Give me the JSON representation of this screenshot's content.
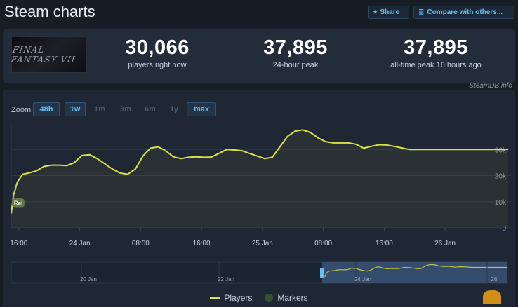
{
  "header": {
    "title": "Steam charts",
    "share_label": "Share",
    "compare_label": "Compare with others..."
  },
  "icons": {
    "share": "share-icon",
    "compare": "compare-icon"
  },
  "stats": {
    "logo_text": "FINAL FANTASY VII",
    "current": {
      "value": "30,066",
      "label": "players right now"
    },
    "peak24": {
      "value": "37,895",
      "label": "24-hour peak"
    },
    "alltime": {
      "value": "37,895",
      "label": "all-time peak 16 hours ago"
    }
  },
  "credit": "SteamDB.info",
  "zoom": {
    "label": "Zoom",
    "options": [
      "48h",
      "1w",
      "1m",
      "3m",
      "6m",
      "1y",
      "max"
    ],
    "active": [
      "48h",
      "1w",
      "max"
    ]
  },
  "legend": {
    "players": "Players",
    "markers": "Markers"
  },
  "colors": {
    "accent": "#66c0f4",
    "series": "#d6e34a",
    "navigator_fill": "#3a5378"
  },
  "chart_data": {
    "type": "area",
    "title": "",
    "series": [
      {
        "name": "Players",
        "x_hours": [
          0,
          0.3,
          0.8,
          1.5,
          2.3,
          3.3,
          4.3,
          5.3,
          6.3,
          7.3,
          8.3,
          9.3,
          10.3,
          11.3,
          12.3,
          13.3,
          14.3,
          15.3,
          16.3,
          17.3,
          18.3,
          19.3,
          20.3,
          21.3,
          22.3,
          23.3,
          24.3,
          25.3,
          26.3,
          27.3,
          28.3,
          29.3,
          30.3,
          31.3,
          32.3,
          33.3,
          34.3,
          35.3,
          36.3,
          37.3,
          38.3,
          39.3,
          40.3,
          41.3,
          42.3,
          43.3,
          44.3,
          45.3,
          46.3,
          47.3,
          48.3,
          49.3,
          50.3,
          51.3,
          52.3,
          53.3,
          54.3,
          55.3,
          56.3,
          57.3,
          58.3,
          59.3,
          60.3,
          61.3,
          62.3,
          63.3,
          64.3,
          65.3
        ],
        "values": [
          5500,
          12500,
          17500,
          20500,
          21000,
          21800,
          23500,
          24000,
          24000,
          23800,
          25000,
          27700,
          28000,
          26500,
          24500,
          22500,
          21000,
          20500,
          22500,
          27500,
          30500,
          31000,
          29500,
          27200,
          26500,
          27000,
          27200,
          27000,
          27100,
          28500,
          30000,
          29800,
          29500,
          28500,
          27500,
          26500,
          27000,
          31000,
          35000,
          37000,
          37500,
          36500,
          34500,
          33000,
          32500,
          32500,
          32500,
          32000,
          30500,
          31200,
          31800,
          31700,
          31200,
          30600,
          30000,
          30000,
          30000,
          30000,
          30000,
          30000,
          30000,
          30000,
          30000,
          30000,
          30000,
          30000,
          30000,
          30066
        ]
      }
    ],
    "x_tick_labels": [
      "16:00",
      "24 Jan",
      "08:00",
      "16:00",
      "25 Jan",
      "08:00",
      "16:00",
      "26 Jan"
    ],
    "x_tick_hours": [
      1,
      9,
      17,
      25,
      33,
      41,
      49,
      57
    ],
    "y_ticks": [
      0,
      10000,
      20000,
      30000
    ],
    "y_tick_labels": [
      "0",
      "10k",
      "20k",
      "30k"
    ],
    "ylim": [
      0,
      40000
    ],
    "xlim_hours": [
      0,
      64
    ],
    "markers": [
      {
        "x_hour": 0.1,
        "value": 9500,
        "label": "Rel"
      }
    ],
    "navigator_labels": [
      "20 Jan",
      "22 Jan",
      "24 Jan",
      "26"
    ],
    "grid": true,
    "legend_position": "bottom-center"
  }
}
